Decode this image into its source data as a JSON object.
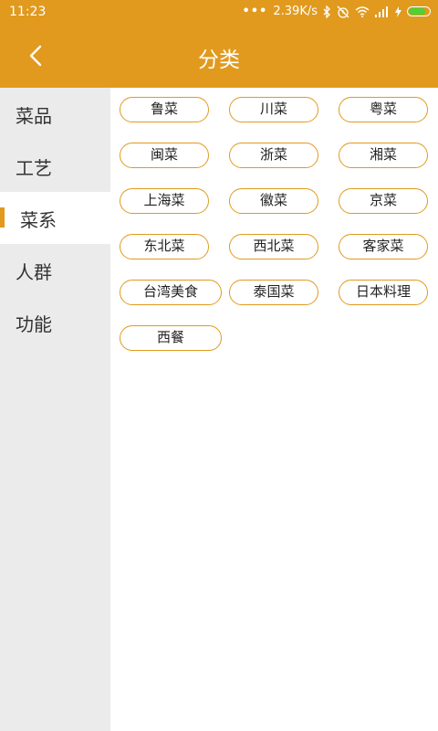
{
  "status": {
    "time": "11:23",
    "dots": "•••",
    "speed": "2.39K/s"
  },
  "colors": {
    "accent": "#e19a1e",
    "sidebar_bg": "#ebebeb",
    "battery": "#4cd137"
  },
  "header": {
    "title": "分类",
    "back_icon": "chevron-left-icon"
  },
  "sidebar": {
    "items": [
      {
        "label": "菜品"
      },
      {
        "label": "工艺"
      },
      {
        "label": "菜系",
        "selected": true
      },
      {
        "label": "人群"
      },
      {
        "label": "功能"
      }
    ]
  },
  "tags": [
    "鲁菜",
    "川菜",
    "粤菜",
    "闽菜",
    "浙菜",
    "湘菜",
    "上海菜",
    "徽菜",
    "京菜",
    "东北菜",
    "西北菜",
    "客家菜",
    "台湾美食",
    "泰国菜",
    "日本料理",
    "西餐"
  ]
}
